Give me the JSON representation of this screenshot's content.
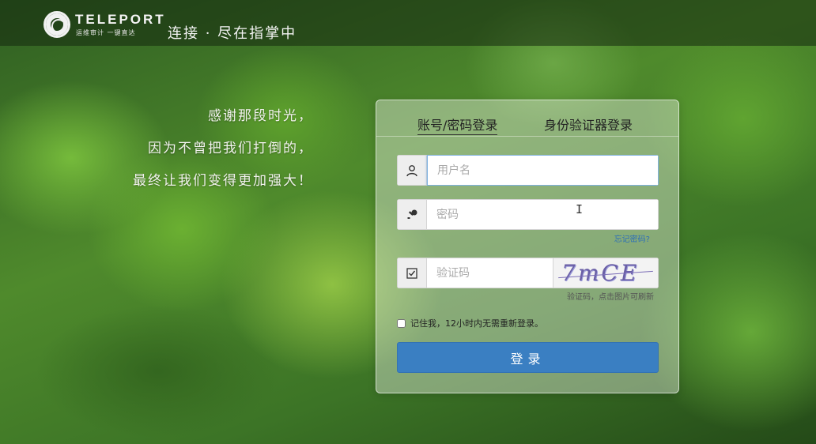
{
  "header": {
    "logo_text": "TELEPORT",
    "logo_sub": "运维审计 一键直达",
    "slogan": "连接 · 尽在指掌中"
  },
  "poem": {
    "lines": [
      "感谢那段时光，",
      "因为不曾把我们打倒的，",
      "最终让我们变得更加强大！"
    ]
  },
  "login": {
    "tabs": [
      {
        "label": "账号/密码登录",
        "active": true
      },
      {
        "label": "身份验证器登录",
        "active": false
      }
    ],
    "username_placeholder": "用户名",
    "password_placeholder": "密码",
    "forgot_label": "忘记密码?",
    "captcha_placeholder": "验证码",
    "captcha_text": "7mCE",
    "captcha_hint": "验证码，点击图片可刷新",
    "remember_label": "记住我，12小时内无需重新登录。",
    "submit_label": "登录"
  },
  "icons": {
    "user": "user-icon",
    "password": "key-icon",
    "captcha": "checkbox-icon"
  },
  "colors": {
    "accent": "#3a7fc2",
    "link": "#2c6fb8"
  }
}
